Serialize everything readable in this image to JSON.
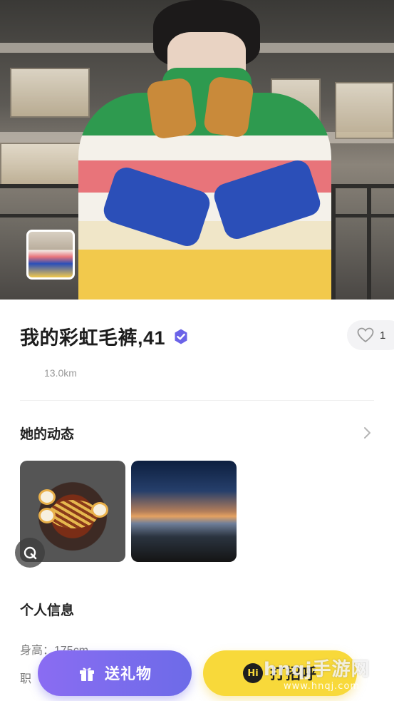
{
  "profile": {
    "name_age": "我的彩虹毛裤,41",
    "distance": "13.0km",
    "likes": "1"
  },
  "moments": {
    "title": "她的动态"
  },
  "personal_info": {
    "title": "个人信息",
    "height": "身高：175cm",
    "partial_line": "职"
  },
  "actions": {
    "gift_label": "送礼物",
    "greet_label": "打招呼",
    "hi_badge": "Hi"
  },
  "watermark": {
    "brand": "hnqj手游网",
    "url": "www.hnqj.com"
  },
  "colors": {
    "verified": "#6b63e8",
    "gift_button": "#7b6bee",
    "greet_button": "#f8d93a"
  }
}
